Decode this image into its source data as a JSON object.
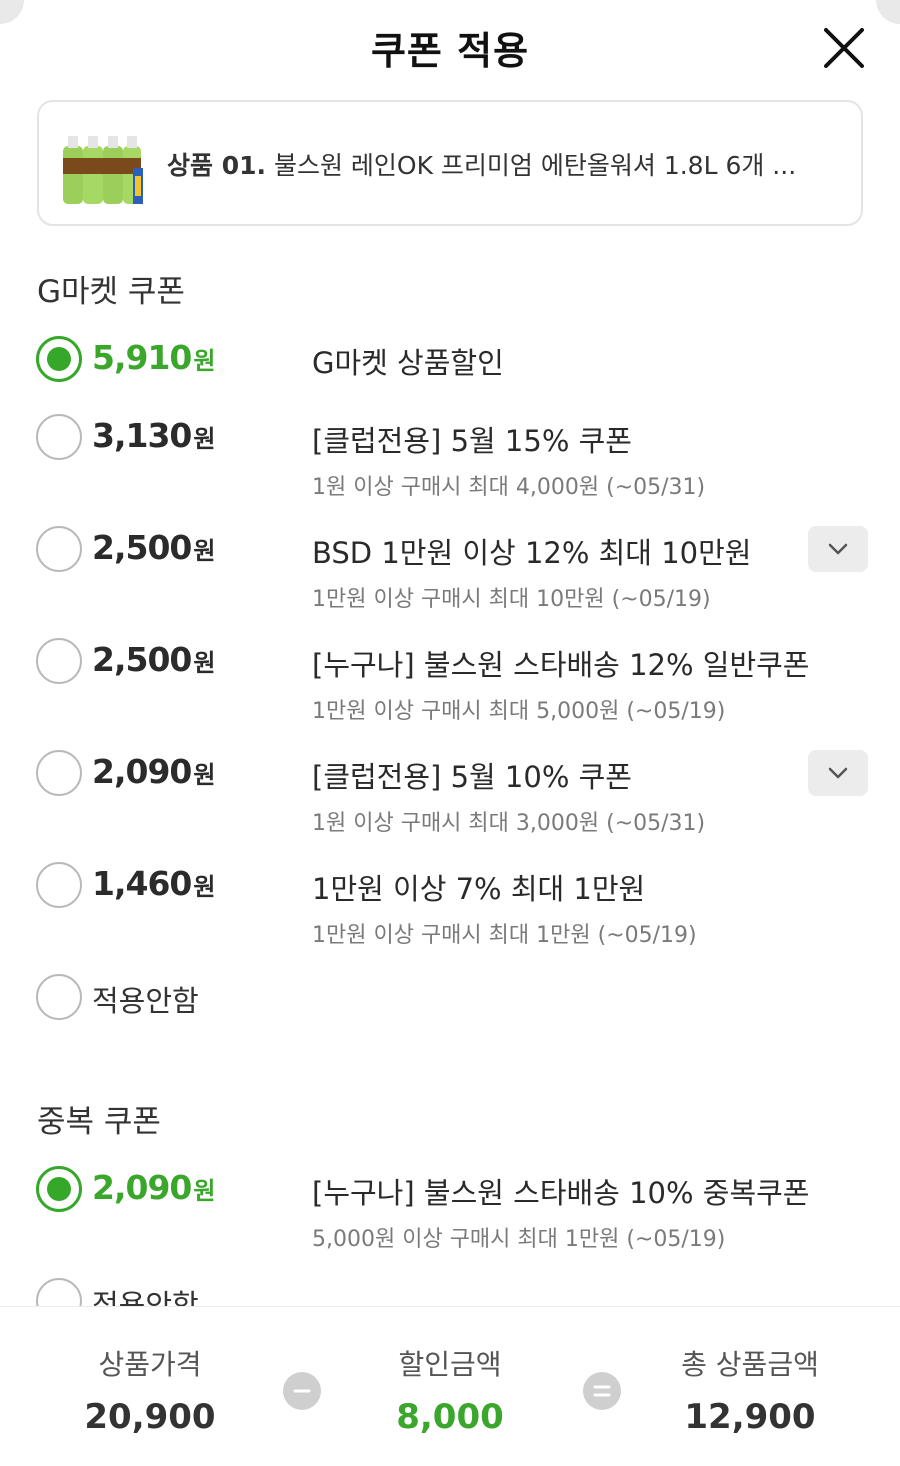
{
  "header": {
    "title": "쿠폰 적용"
  },
  "product": {
    "prefix": "상품 01.",
    "name": "불스원 레인OK 프리미엄 에탄올워셔 1.8L 6개 ..."
  },
  "gmarket_section": {
    "title": "G마켓 쿠폰",
    "coupons": [
      {
        "amount": "5,910",
        "unit": "원",
        "name": "G마켓 상품할인",
        "desc": "",
        "selected": true
      },
      {
        "amount": "3,130",
        "unit": "원",
        "name": "[클럽전용] 5월 15% 쿠폰",
        "desc": "1원 이상 구매시 최대 4,000원 (~05/31)",
        "selected": false
      },
      {
        "amount": "2,500",
        "unit": "원",
        "name": "BSD 1만원 이상 12% 최대 10만원",
        "desc": "1만원 이상 구매시 최대 10만원 (~05/19)",
        "selected": false
      },
      {
        "amount": "2,500",
        "unit": "원",
        "name": "[누구나] 불스원 스타배송 12% 일반쿠폰",
        "desc": "1만원 이상 구매시 최대 5,000원 (~05/19)",
        "selected": false
      },
      {
        "amount": "2,090",
        "unit": "원",
        "name": "[클럽전용] 5월 10% 쿠폰",
        "desc": "1원 이상 구매시 최대 3,000원 (~05/31)",
        "selected": false
      },
      {
        "amount": "1,460",
        "unit": "원",
        "name": "1만원 이상 7% 최대 1만원",
        "desc": "1만원 이상 구매시 최대 1만원 (~05/19)",
        "selected": false
      }
    ],
    "none_label": "적용안함"
  },
  "duplicate_section": {
    "title": "중복 쿠폰",
    "coupons": [
      {
        "amount": "2,090",
        "unit": "원",
        "name": "[누구나] 불스원 스타배송 10% 중복쿠폰",
        "desc": "5,000원 이상 구매시 최대 1만원 (~05/19)",
        "selected": true
      }
    ],
    "none_label": "적용안함"
  },
  "footer": {
    "price_label": "상품가격",
    "price_value": "20,900",
    "discount_label": "할인금액",
    "discount_value": "8,000",
    "total_label": "총 상품금액",
    "total_value": "12,900"
  },
  "colors": {
    "accent": "#3aa62c",
    "text": "#222222",
    "muted": "#7a7a7a"
  },
  "icons": {
    "close": "close-icon",
    "chevron": "chevron-down-icon",
    "minus": "minus-icon",
    "equals": "equals-icon"
  }
}
